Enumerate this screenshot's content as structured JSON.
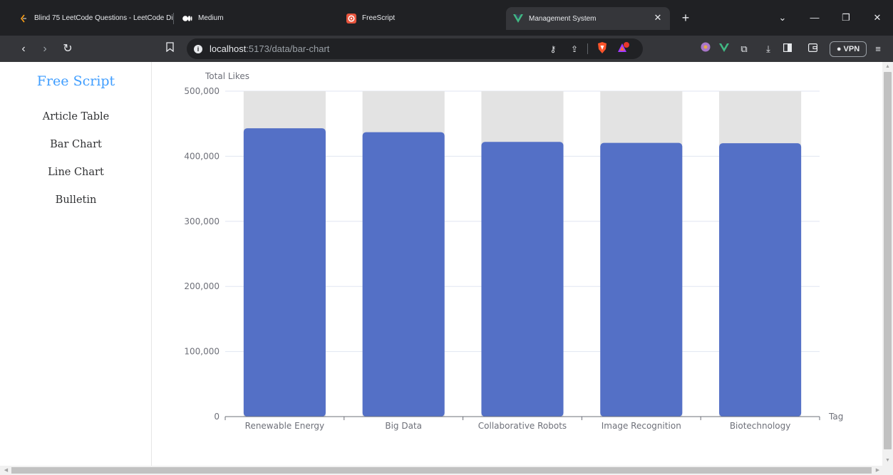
{
  "browser": {
    "tabs": [
      {
        "title": "Blind 75 LeetCode Questions - LeetCode Di",
        "icon": "leetcode-icon"
      },
      {
        "title": "Medium",
        "icon": "medium-icon"
      },
      {
        "title": "FreeScript",
        "icon": "freescript-icon"
      },
      {
        "title": "Management System",
        "icon": "vue-icon",
        "active": true
      }
    ],
    "url_host": "localhost",
    "url_path": ":5173/data/bar-chart",
    "vpn_label": "VPN"
  },
  "sidebar": {
    "brand": "Free Script",
    "items": [
      "Article Table",
      "Bar Chart",
      "Line Chart",
      "Bulletin"
    ]
  },
  "colors": {
    "bar": "#5470c6",
    "bar_background": "#e3e3e3",
    "brand": "#409eff",
    "gridline": "#e0e6f1"
  },
  "chart_data": {
    "type": "bar",
    "title": "",
    "ylabel": "Total Likes",
    "xlabel": "Tag",
    "categories": [
      "Renewable Energy",
      "Big Data",
      "Collaborative Robots",
      "Image Recognition",
      "Biotechnology"
    ],
    "values": [
      443000,
      437000,
      422000,
      420500,
      420000
    ],
    "ylim": [
      0,
      500000
    ],
    "yticks": [
      "0",
      "100,000",
      "200,000",
      "300,000",
      "400,000",
      "500,000"
    ],
    "grid": true,
    "show_background": true
  }
}
